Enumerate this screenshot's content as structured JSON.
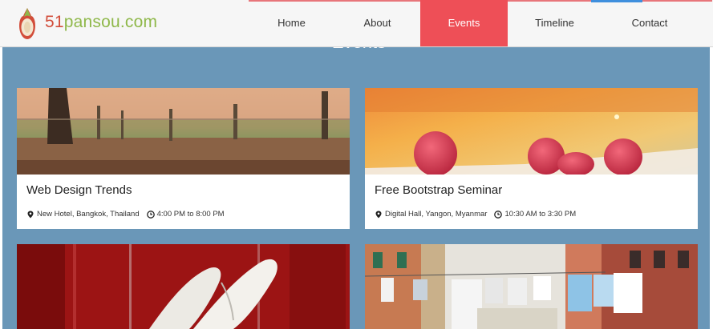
{
  "brand": {
    "num": "51",
    "rest": "pansou.com"
  },
  "nav": {
    "items": [
      {
        "label": "Home",
        "active": false
      },
      {
        "label": "About",
        "active": false
      },
      {
        "label": "Events",
        "active": true
      },
      {
        "label": "Timeline",
        "active": false
      },
      {
        "label": "Contact",
        "active": false
      }
    ]
  },
  "section": {
    "title": "Events"
  },
  "events": [
    {
      "title": "Web Design Trends",
      "location": "New Hotel, Bangkok, Thailand",
      "time": "4:00 PM to 8:00 PM"
    },
    {
      "title": "Free Bootstrap Seminar",
      "location": "Digital Hall, Yangon, Myanmar",
      "time": "10:30 AM to 3:30 PM"
    }
  ],
  "icons": {
    "location": "map-marker-icon",
    "time": "clock-icon"
  },
  "colors": {
    "accent": "#ee4f57",
    "section_bg": "#6a97b8",
    "logo_red": "#d24d3a",
    "logo_green": "#8fb84a"
  }
}
